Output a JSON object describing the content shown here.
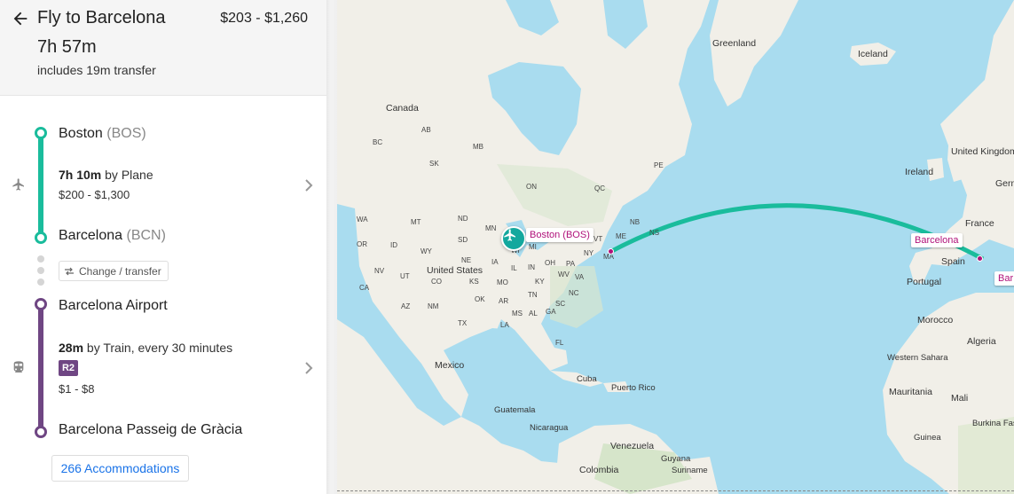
{
  "header": {
    "title": "Fly to Barcelona",
    "price_range": "$203 - $1,260",
    "duration": "7h 57m",
    "transfer_note": "includes 19m transfer"
  },
  "itinerary": {
    "origin": {
      "name": "Boston",
      "code": "(BOS)"
    },
    "flight": {
      "duration": "7h 10m",
      "mode": "by Plane",
      "price": "$200 - $1,300"
    },
    "destination_airport": {
      "name": "Barcelona",
      "code": "(BCN)"
    },
    "transfer_label": "Change / transfer",
    "train_start": "Barcelona Airport",
    "train": {
      "duration": "28m",
      "mode": "by Train, every 30 minutes",
      "line": "R2",
      "price": "$1 - $8"
    },
    "train_end": "Barcelona Passeig de Gràcia",
    "accommodations": "266 Accommodations"
  },
  "map": {
    "marker_boston": "Boston (BOS)",
    "marker_barcelona": "Barcelona",
    "marker_barcelona_edge": "Bar",
    "countries": {
      "greenland": "Greenland",
      "iceland": "Iceland",
      "canada": "Canada",
      "united_kingdom": "United Kingdom",
      "ireland": "Ireland",
      "france": "France",
      "spain": "Spain",
      "portugal": "Portugal",
      "morocco": "Morocco",
      "algeria": "Algeria",
      "western_sahara": "Western Sahara",
      "mauritania": "Mauritania",
      "mali": "Mali",
      "burkina_faso": "Burkina Faso",
      "guinea": "Guinea",
      "united_states": "United States",
      "mexico": "Mexico",
      "cuba": "Cuba",
      "puerto_rico": "Puerto Rico",
      "guatemala": "Guatemala",
      "nicaragua": "Nicaragua",
      "venezuela": "Venezuela",
      "guyana": "Guyana",
      "suriname": "Suriname",
      "colombia": "Colombia",
      "germany_partial": "Germ"
    },
    "provinces": [
      "AB",
      "MB",
      "SK",
      "ON",
      "QC",
      "NB",
      "NS",
      "PE",
      "BC"
    ],
    "states": [
      "WA",
      "MT",
      "ND",
      "MN",
      "SD",
      "OR",
      "ID",
      "WY",
      "NE",
      "NV",
      "UT",
      "CO",
      "KS",
      "MO",
      "CA",
      "AZ",
      "NM",
      "OK",
      "AR",
      "TX",
      "LA",
      "MS",
      "AL",
      "GA",
      "FL",
      "TN",
      "KY",
      "IL",
      "IN",
      "OH",
      "WV",
      "VA",
      "NC",
      "SC",
      "PA",
      "NY",
      "VT",
      "ME",
      "MA",
      "MI",
      "WI",
      "IA"
    ]
  },
  "colors": {
    "flight": "#1abc9c",
    "train": "#6f4683",
    "accent_pink": "#b0127a",
    "water": "#a9dcef",
    "link": "#1a73e8"
  }
}
